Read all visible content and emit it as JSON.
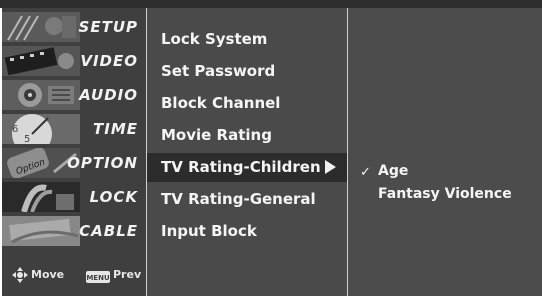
{
  "main_menu": {
    "items": [
      {
        "label": "SETUP",
        "icon": "setup-icon"
      },
      {
        "label": "VIDEO",
        "icon": "video-icon"
      },
      {
        "label": "AUDIO",
        "icon": "audio-icon"
      },
      {
        "label": "TIME",
        "icon": "time-icon"
      },
      {
        "label": "OPTION",
        "icon": "option-icon"
      },
      {
        "label": "LOCK",
        "icon": "lock-icon"
      },
      {
        "label": "CABLE",
        "icon": "cable-icon"
      }
    ],
    "footer": {
      "move_label": "Move",
      "menu_key_label": "MENU",
      "prev_label": "Prev"
    }
  },
  "lock_menu": {
    "items": [
      {
        "label": "Lock System"
      },
      {
        "label": "Set Password"
      },
      {
        "label": "Block Channel"
      },
      {
        "label": "Movie Rating"
      },
      {
        "label": "TV Rating-Children",
        "selected": true
      },
      {
        "label": "TV Rating-General"
      },
      {
        "label": "Input Block"
      }
    ]
  },
  "tv_rating_children": {
    "options": [
      {
        "label": "Age",
        "checked": true
      },
      {
        "label": "Fantasy Violence",
        "checked": false
      }
    ],
    "check_mark": "✓"
  },
  "colors": {
    "background": "#ffffff",
    "left_panel": "#3f3f3f",
    "middle_panel": "#4a4a4a",
    "right_panel": "#4c4c4c",
    "selection": "#2c2c2c",
    "text": "#f5f5f5"
  }
}
